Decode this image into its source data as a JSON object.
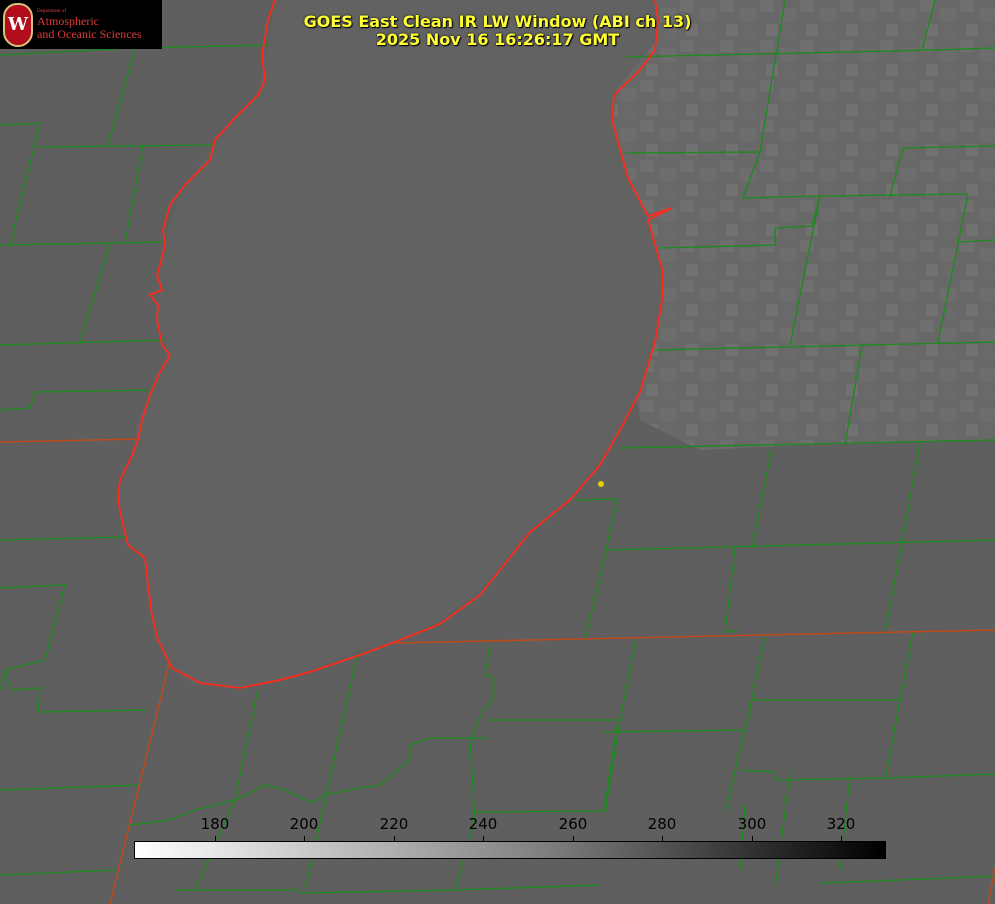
{
  "title": {
    "line1": "GOES East Clean IR LW Window (ABI ch 13)",
    "line2": "2025 Nov 16 16:26:17 GMT"
  },
  "logo": {
    "seal_letter": "W",
    "dept": "Department of",
    "line1": "Atmospheric",
    "line2": "and Oceanic Sciences"
  },
  "colorbar": {
    "ticks": [
      "180",
      "200",
      "220",
      "240",
      "260",
      "280",
      "300",
      "320"
    ],
    "min_value": 162,
    "max_value": 330,
    "gradient": [
      "#ffffff",
      "#000000"
    ]
  },
  "colors": {
    "background": "#5f5f5f",
    "lake": "#626262",
    "county_lines": "#1a8c1a",
    "state_lines": "#c04a1a",
    "coastline": "#ff2a1a",
    "title": "#ffff33",
    "marker": "#e0d000"
  }
}
